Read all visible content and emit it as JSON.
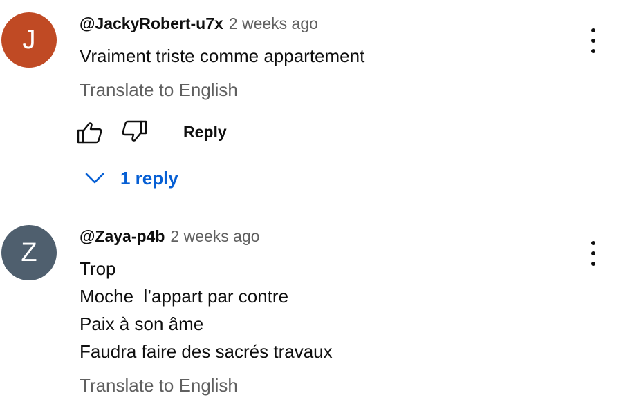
{
  "comments": [
    {
      "avatar_letter": "J",
      "avatar_color": "#c04a24",
      "author": "@JackyRobert-u7x",
      "time": "2 weeks ago",
      "text_lines": [
        "Vraiment triste comme appartement"
      ],
      "translate_label": "Translate to English",
      "like_icon": "thumbs-up-icon",
      "dislike_icon": "thumbs-down-icon",
      "reply_label": "Reply",
      "replies_label": "1 reply",
      "menu_icon": "more-vert-icon"
    },
    {
      "avatar_letter": "Z",
      "avatar_color": "#4f5f6e",
      "author": "@Zaya-p4b",
      "time": "2 weeks ago",
      "text_lines": [
        "Trop",
        "Moche  l’appart par contre",
        "Paix à son âme",
        "Faudra faire des sacrés travaux"
      ],
      "translate_label": "Translate to English",
      "menu_icon": "more-vert-icon"
    }
  ],
  "colors": {
    "text_primary": "#0f0f0f",
    "text_secondary": "#606060",
    "link_blue": "#065fd4"
  }
}
